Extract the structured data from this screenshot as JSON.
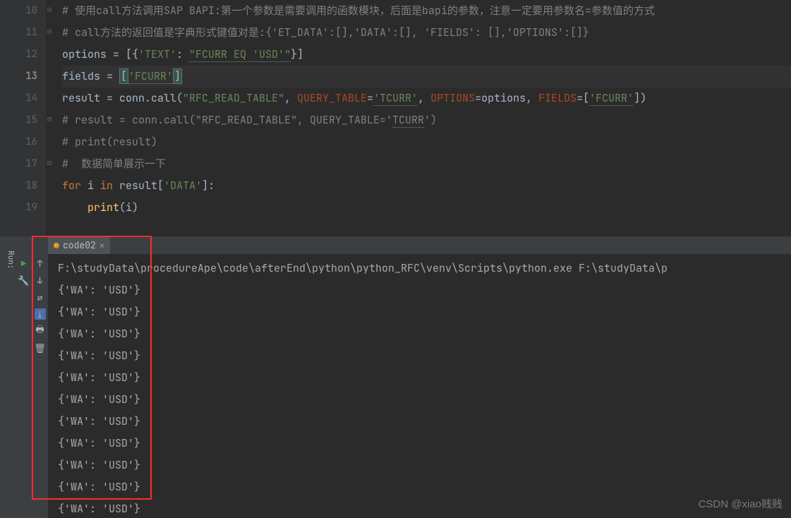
{
  "gutter": {
    "start": 10,
    "end": 19,
    "current": 13
  },
  "code": {
    "l10": {
      "c": "# 使用call方法调用SAP BAPI:第一个参数是需要调用的函数模块，后面是bapi的参数，注意一定要用参数名=参数值的方式"
    },
    "l11": {
      "c": "# call方法的返回值是字典形式键值对是:{'ET_DATA':[],'DATA':[], 'FIELDS': [],'OPTIONS':[]}"
    },
    "l12": {
      "i": "options = [{",
      "s1": "'TEXT'",
      "m": ": ",
      "s2": "\"FCURR EQ 'USD'\"",
      "e": "}]"
    },
    "l13": {
      "i": "fields = ",
      "b1": "[",
      "s": "'FCURR'",
      "b2": "]"
    },
    "l14": {
      "a": "result = conn.call(",
      "s1": "\"RFC_READ_TABLE\"",
      "c1": ", ",
      "p1": "QUERY_TABLE",
      "eq": "=",
      "s2": "'TCURR'",
      "c2": ", ",
      "p2": "OPTIONS",
      "v2": "=options, ",
      "p3": "FIELDS",
      "v3": "=[",
      "s3": "'FCURR'",
      "e": "])"
    },
    "l15": {
      "c": "# result = conn.call(\"RFC_READ_TABLE\", QUERY_TABLE='",
      "u": "TCURR",
      "c2": "')"
    },
    "l16": {
      "c": "# print(result)"
    },
    "l17": {
      "c": "#  数据简单展示一下"
    },
    "l18": {
      "k1": "for ",
      "i": "i ",
      "k2": "in ",
      "r": "result[",
      "s": "'DATA'",
      "e": "]:"
    },
    "l19": {
      "f": "print",
      "a": "(i)"
    }
  },
  "run": {
    "label": "Run:",
    "tab": "code02",
    "path": "F:\\studyData\\procedureApe\\code\\afterEnd\\python\\python_RFC\\venv\\Scripts\\python.exe F:\\studyData\\p",
    "rows": [
      "{'WA': 'USD'}",
      "{'WA': 'USD'}",
      "{'WA': 'USD'}",
      "{'WA': 'USD'}",
      "{'WA': 'USD'}",
      "{'WA': 'USD'}",
      "{'WA': 'USD'}",
      "{'WA': 'USD'}",
      "{'WA': 'USD'}",
      "{'WA': 'USD'}",
      "{'WA': 'USD'}"
    ]
  },
  "watermark": "CSDN @xiao贱贱"
}
